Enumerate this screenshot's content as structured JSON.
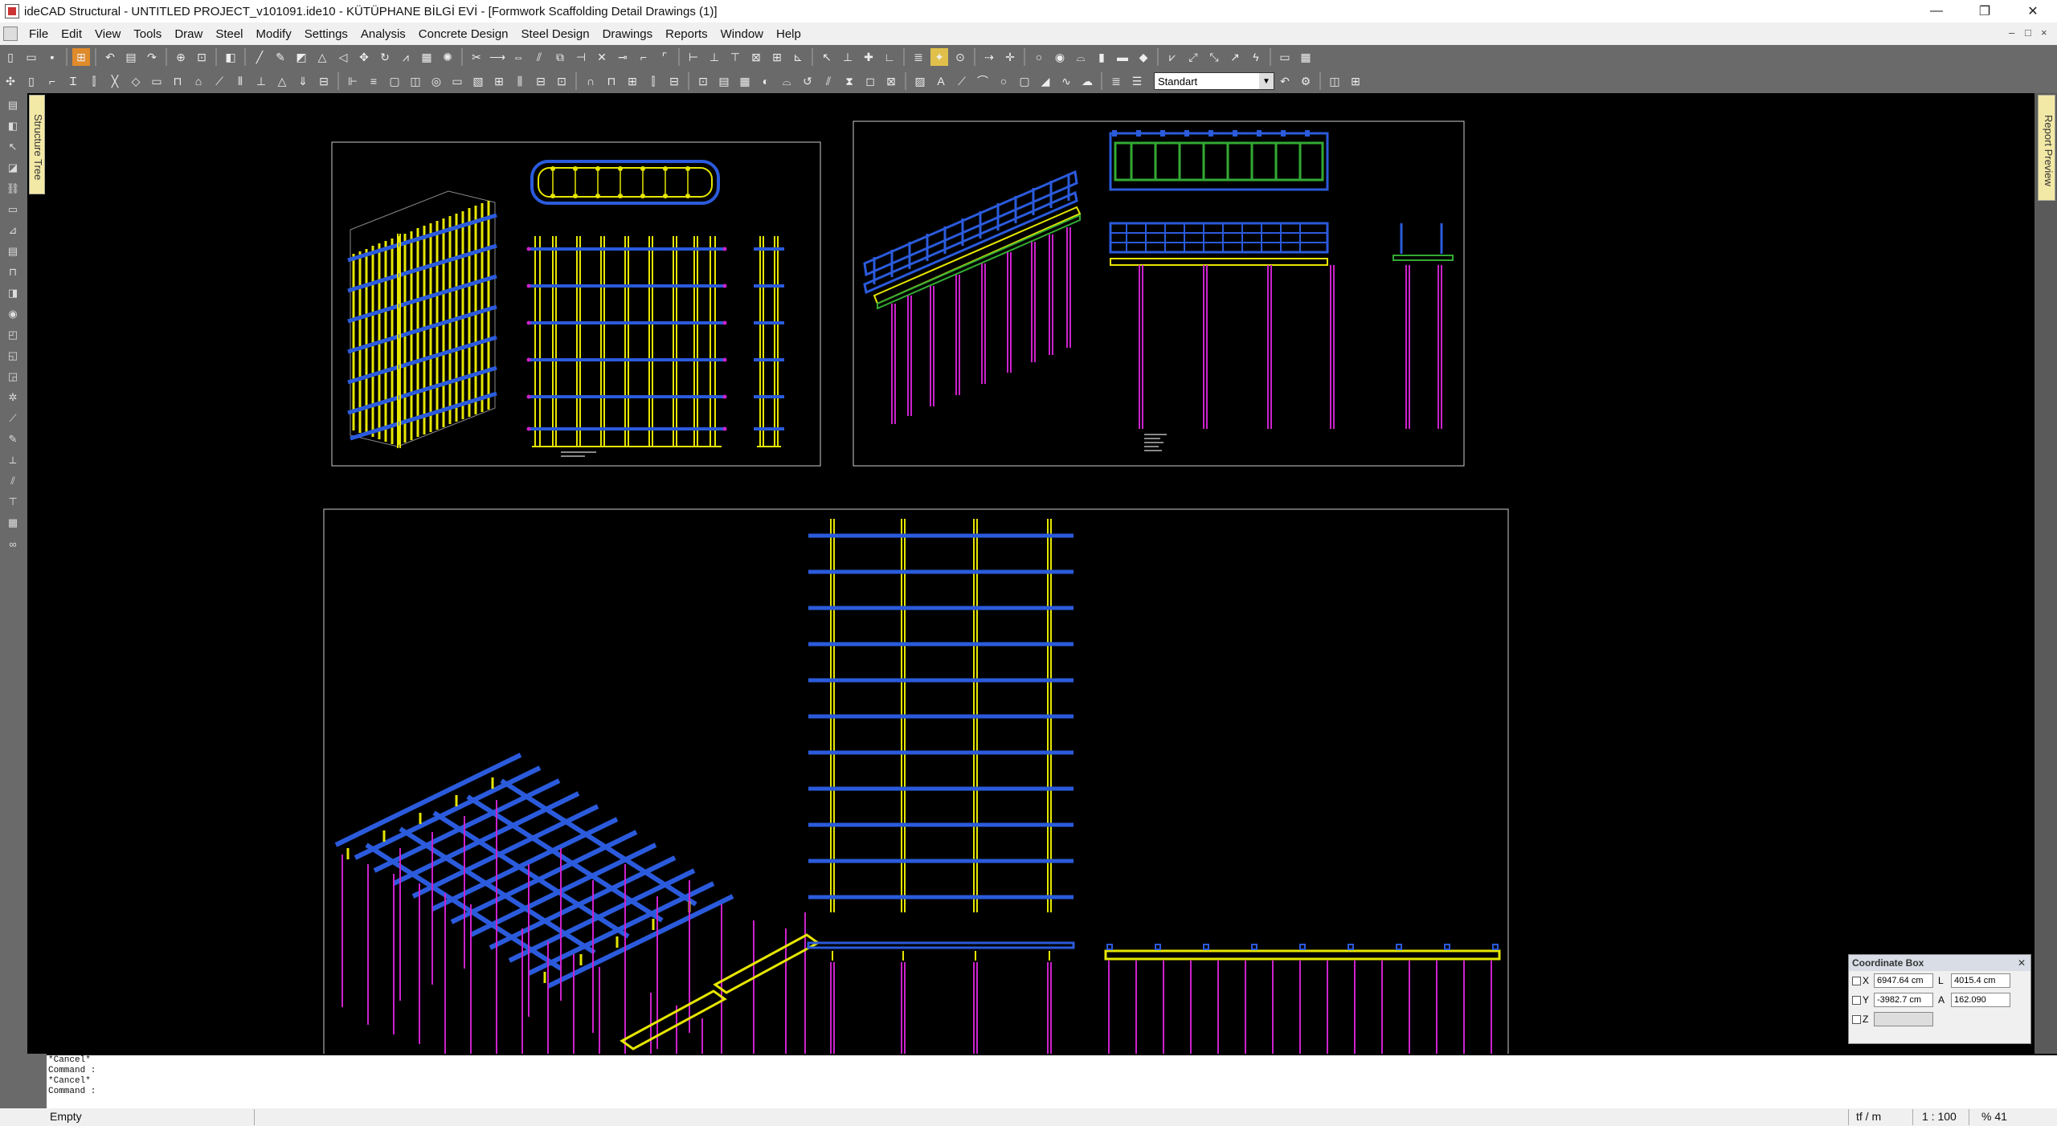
{
  "window": {
    "title": "ideCAD Structural - UNTITLED PROJECT_v101091.ide10 - KÜTÜPHANE BİLGİ EVİ - [Formwork Scaffolding Detail Drawings (1)]",
    "minimize": "—",
    "restore": "❐",
    "close": "✕"
  },
  "menu": {
    "items": [
      "File",
      "Edit",
      "View",
      "Tools",
      "Draw",
      "Steel",
      "Modify",
      "Settings",
      "Analysis",
      "Concrete Design",
      "Steel Design",
      "Drawings",
      "Reports",
      "Window",
      "Help"
    ],
    "mdi_minimize": "–",
    "mdi_restore": "□",
    "mdi_close": "×"
  },
  "toolbar": {
    "style_combo_value": "Standart"
  },
  "side_tabs": {
    "structure_tree": "Structure Tree",
    "report_preview": "Report Preview"
  },
  "command": {
    "lines": [
      "*Cancel*",
      "Command :",
      "*Cancel*",
      "Command :"
    ]
  },
  "status": {
    "left": "Empty",
    "unit": "tf / m",
    "scale": "1 : 100",
    "zoom": "% 41"
  },
  "coordinate_box": {
    "title": "Coordinate Box",
    "x_label": "X",
    "y_label": "Y",
    "z_label": "Z",
    "x_value": "6947.64 cm",
    "y_value": "-3982.7 cm",
    "z_value": "",
    "l_label": "L",
    "a_label": "A",
    "l_value": "4015.4 cm",
    "a_value": "162.090",
    "close": "✕"
  },
  "colors": {
    "yellow": "#e6e600",
    "blue": "#2b5bdc",
    "magenta": "#cc22cc",
    "frame": "#cccccc",
    "green": "#33aa33"
  }
}
